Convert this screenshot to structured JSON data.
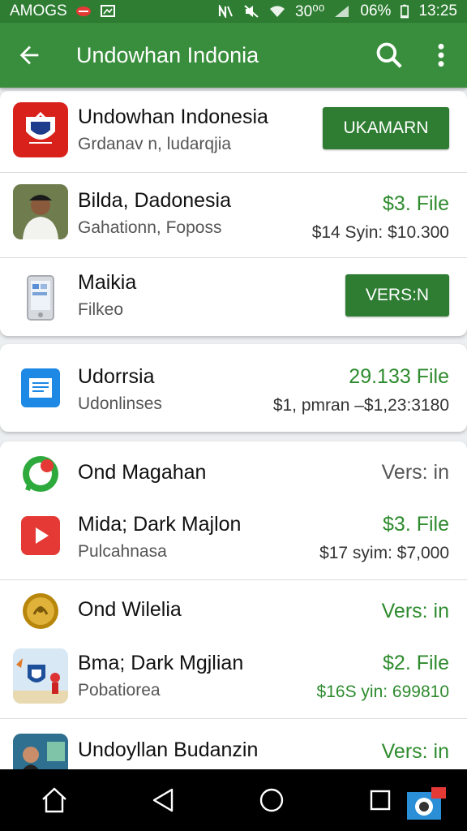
{
  "statusbar": {
    "carrier": "AMOGS",
    "signal_text": "30⁰⁰",
    "battery": "06%",
    "time": "13:25"
  },
  "appbar": {
    "title": "Undowhan Indonia",
    "back_icon": "arrow-left-icon",
    "search_icon": "search-icon",
    "menu_icon": "more-vert-icon"
  },
  "colors": {
    "primary": "#388e3c",
    "primary_dark": "#2e7d32",
    "price_green": "#2e8b2e"
  },
  "card1": {
    "items": [
      {
        "name": "Undowhan Indonesia",
        "sub": "Grdanav n, ludarqjia",
        "button": "UKAMARN"
      },
      {
        "name": "Bilda, Dadonesia",
        "sub": "Gahationn, Foposs",
        "price": "$3. File",
        "range": "$14 Syin: $10.300"
      },
      {
        "name": "Maikia",
        "sub": "Filkeo",
        "button": "VERS:N"
      }
    ]
  },
  "card2": {
    "items": [
      {
        "name": "Udorrsia",
        "sub": "Udonlinses",
        "price": "29.133 File",
        "range": "$1, pmran –$1,23:3180"
      }
    ]
  },
  "card3": {
    "items": [
      {
        "name": "Ond Magahan",
        "price": "Vers: in"
      },
      {
        "name": "Mida; Dark Majlon",
        "sub": "Pulcahnasa",
        "price": "$3. File",
        "range": "$17 syim: $7,000"
      },
      {
        "name": "Ond Wilelia",
        "price": "Vers: in"
      },
      {
        "name": "Bma; Dark Mgjlian",
        "sub": "Pobatiorea",
        "price": "$2. File",
        "range": "$16S yin: 699810"
      },
      {
        "name": "Undoyllan Budanzin",
        "price": "Vers: in"
      }
    ]
  },
  "navbar": {
    "home_icon": "home-icon",
    "back_icon": "triangle-back-icon",
    "circle_icon": "circle-home-icon",
    "recents_icon": "square-recents-icon"
  }
}
